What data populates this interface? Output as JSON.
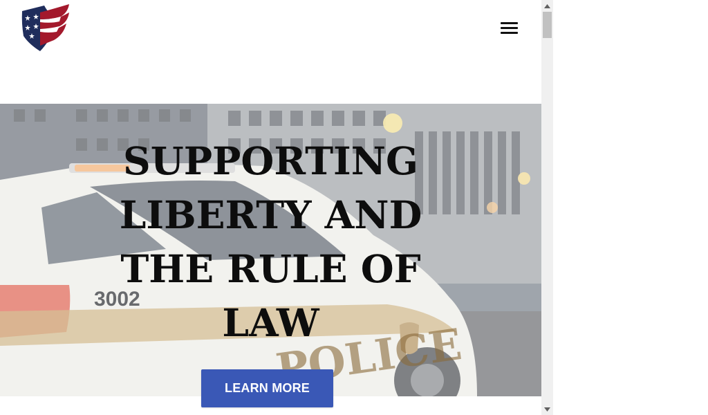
{
  "header": {
    "logo_name": "shield-flag-logo",
    "menu_icon": "hamburger-menu-icon"
  },
  "hero": {
    "title_lines": [
      "SUPPORTING",
      "LIBERTY AND",
      "THE RULE OF",
      "LAW"
    ],
    "background_label": "police car street scene",
    "car_number": "3002",
    "car_word": "POLICE",
    "cta_label": "LEARN MORE"
  },
  "colors": {
    "cta": "#3a58b6",
    "logo_blue": "#1f2d5c",
    "logo_red": "#a3192c",
    "scrollbar_track": "#f0f0f0",
    "scrollbar_thumb": "#c1c1c1"
  },
  "scrollbar": {
    "up_icon": "scroll-up-arrow-icon",
    "down_icon": "scroll-down-arrow-icon"
  }
}
